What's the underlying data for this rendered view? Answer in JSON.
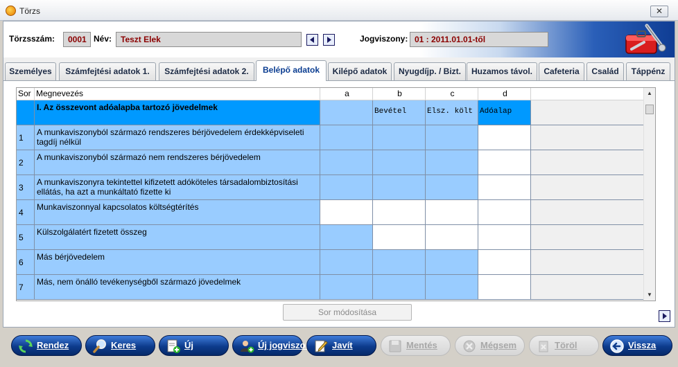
{
  "window": {
    "title": "Törzs",
    "close_label": "✕"
  },
  "header": {
    "torzsszam_label": "Törzsszám:",
    "torzsszam_value": "0001",
    "nev_label": "Név:",
    "nev_value": "Teszt Elek",
    "jogviszony_label": "Jogviszony:",
    "jogviszony_value": "01 : 2011.01.01-től"
  },
  "tabs": [
    {
      "label": "Személyes"
    },
    {
      "label": "Számfejtési adatok 1."
    },
    {
      "label": "Számfejtési adatok 2."
    },
    {
      "label": "Belépő adatok",
      "active": true
    },
    {
      "label": "Kilépő adatok"
    },
    {
      "label": "Nyugdíjp. / Bizt."
    },
    {
      "label": "Huzamos távol."
    },
    {
      "label": "Cafeteria"
    },
    {
      "label": "Család"
    },
    {
      "label": "Táppénz"
    }
  ],
  "grid": {
    "columns": {
      "sor": "Sor",
      "megnevezes": "Megnevezés",
      "a": "a",
      "b": "b",
      "c": "c",
      "d": "d"
    },
    "section": {
      "title": "I. Az összevont adóalapba tartozó jövedelmek",
      "b": "Bevétel",
      "c": "Elsz. költ",
      "d": "Adóalap"
    },
    "rows": [
      {
        "num": "1",
        "desc": "A munkaviszonyból származó rendszeres bérjövedelem érdekképviseleti tagdíj nélkül"
      },
      {
        "num": "2",
        "desc": "A munkaviszonyból származó nem rendszeres bérjövedelem"
      },
      {
        "num": "3",
        "desc": "A munkaviszonyra tekintettel kifizetett adóköteles társadalombiztosítási ellátás, ha azt a munkáltató fizette ki"
      },
      {
        "num": "4",
        "desc": "Munkaviszonnyal kapcsolatos költségtérítés"
      },
      {
        "num": "5",
        "desc": "Külszolgálatért fizetett összeg"
      },
      {
        "num": "6",
        "desc": "Más bérjövedelem"
      },
      {
        "num": "7",
        "desc": "Más, nem önálló tevékenységből származó jövedelmek"
      }
    ]
  },
  "sor_modositasa_label": "Sor módosítása",
  "toolbar": {
    "rendez": "Rendez",
    "keres": "Keres",
    "uj": "Új",
    "uj_jogviszony": "Új jogviszony",
    "javit": "Javít",
    "mentes": "Mentés",
    "megsem": "Mégsem",
    "torol": "Töröl",
    "vissza": "Vissza"
  },
  "colors": {
    "accent": "#0b3d91",
    "cell_blue": "#99ccff",
    "section_blue": "#0099ff",
    "value_text": "#8b0000"
  }
}
